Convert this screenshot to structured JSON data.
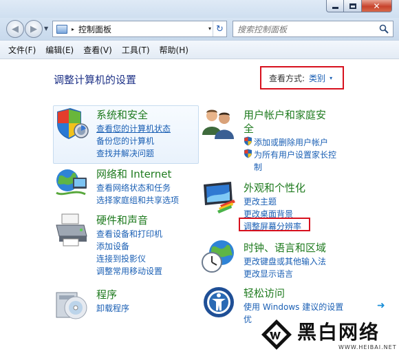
{
  "window": {
    "minimize_glyph": "—",
    "maximize_glyph": "□",
    "close_glyph": "✕"
  },
  "navigation": {
    "breadcrumb_separator": "▸",
    "address_text": "控制面板",
    "address_dropdown": "▾",
    "refresh_glyph": "↻",
    "search_placeholder": "搜索控制面板"
  },
  "menu": [
    "文件(F)",
    "编辑(E)",
    "查看(V)",
    "工具(T)",
    "帮助(H)"
  ],
  "page": {
    "title": "调整计算机的设置",
    "view_by_label": "查看方式:",
    "view_by_value": "类别",
    "view_by_caret": "▾"
  },
  "categories": {
    "system": {
      "title": "系统和安全",
      "links": [
        "查看您的计算机状态",
        "备份您的计算机",
        "查找并解决问题"
      ]
    },
    "network": {
      "title": "网络和 Internet",
      "links": [
        "查看网络状态和任务",
        "选择家庭组和共享选项"
      ]
    },
    "hardware": {
      "title": "硬件和声音",
      "links": [
        "查看设备和打印机",
        "添加设备",
        "连接到投影仪",
        "调整常用移动设置"
      ]
    },
    "programs": {
      "title": "程序",
      "links": [
        "卸载程序"
      ]
    },
    "users": {
      "title_line1": "用户帐户和家庭安",
      "title_line2": "全",
      "links": [
        "添加或删除用户帐户",
        "为所有用户设置家长控",
        "制"
      ]
    },
    "appearance": {
      "title": "外观和个性化",
      "links": [
        "更改主题",
        "更改桌面背景",
        "调整屏幕分辨率"
      ]
    },
    "clock": {
      "title": "时钟、语言和区域",
      "links": [
        "更改键盘或其他输入法",
        "更改显示语言"
      ]
    },
    "ease": {
      "title": "轻松访问",
      "links": [
        "使用 Windows 建议的设置",
        "优"
      ]
    }
  },
  "watermark": {
    "logo_text": "BW",
    "title": "黑白网络",
    "url": "WWW.HEIBAI.NET"
  },
  "icons": {
    "system": "shield-security-icon",
    "network": "network-globe-icon",
    "hardware": "printer-hardware-icon",
    "programs": "programs-cd-icon",
    "users": "users-accounts-icon",
    "appearance": "monitor-appearance-icon",
    "clock": "globe-clock-icon",
    "ease": "ease-of-access-icon"
  },
  "colors": {
    "link": "#1a5fb4",
    "category_title": "#1e7a1e",
    "page_title": "#1e3287",
    "highlight_box": "#d7101d"
  }
}
